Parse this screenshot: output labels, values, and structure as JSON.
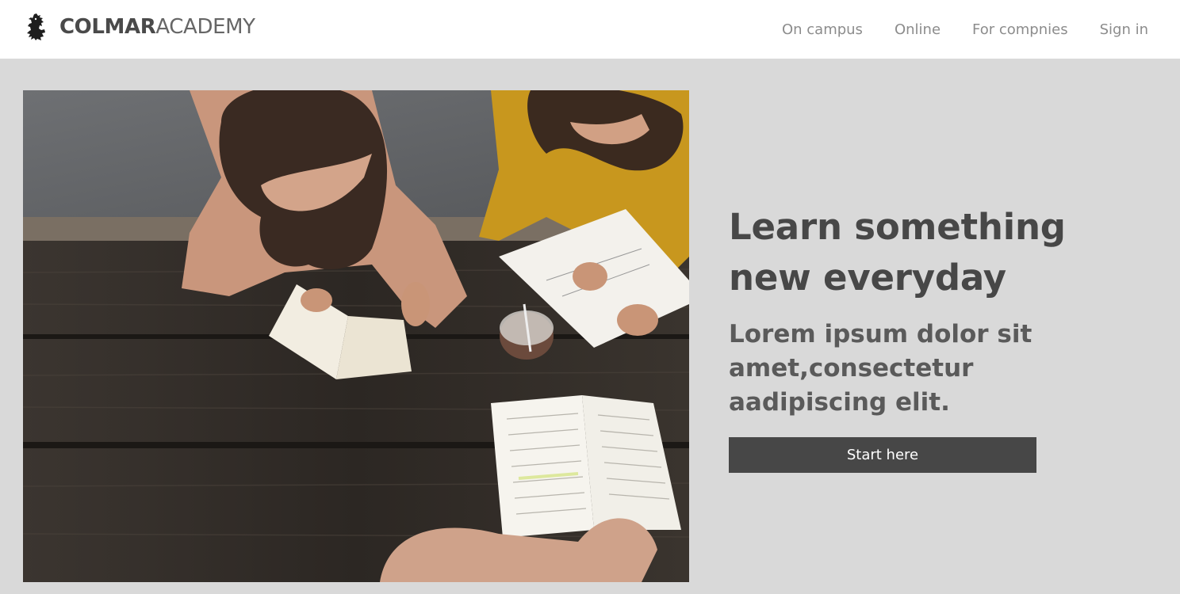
{
  "header": {
    "brand": {
      "logo_icon": "lion-rampant-icon",
      "name_bold": "COLMAR",
      "name_light": "ACADEMY"
    },
    "nav": [
      {
        "label": "On campus"
      },
      {
        "label": "Online"
      },
      {
        "label": "For compnies"
      },
      {
        "label": "Sign in"
      }
    ]
  },
  "hero": {
    "image_icon": "students-studying-photo",
    "title_line1": "Learn something",
    "title_line2": "new everyday",
    "subtitle": "Lorem ipsum dolor sit amet,consectetur aadipiscing elit.",
    "cta_label": "Start here"
  },
  "colors": {
    "page_background": "#d9d9d9",
    "header_background": "#ffffff",
    "nav_text": "#8c8c8c",
    "heading_text": "#474747",
    "button_background": "#474747",
    "button_text": "#ffffff"
  }
}
